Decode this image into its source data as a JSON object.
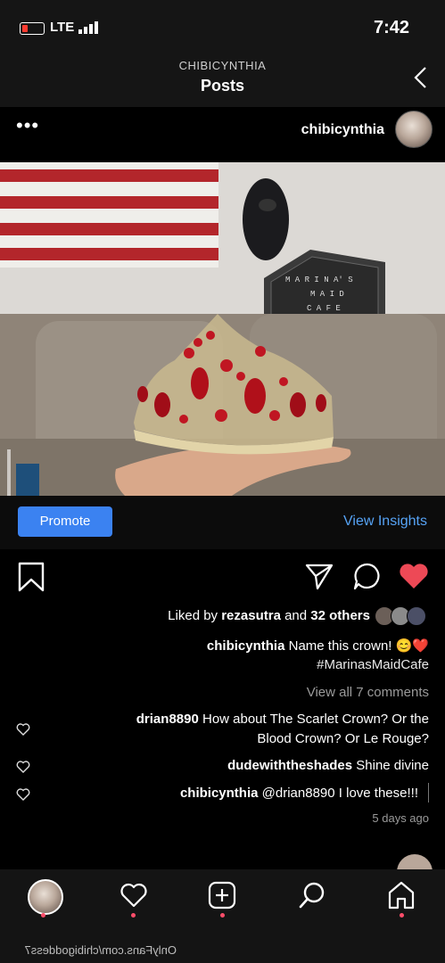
{
  "status_bar": {
    "network": "LTE",
    "time": "7:42"
  },
  "header": {
    "username": "CHIBICYNTHIA",
    "title": "Posts"
  },
  "post": {
    "username": "chibicynthia",
    "more": "•••",
    "promote_label": "Promote",
    "insights_label": "View Insights",
    "likes": {
      "prefix": "Liked by ",
      "user": "rezasutra",
      "middle": " and ",
      "others": "32 others"
    },
    "caption": {
      "user": "chibicynthia",
      "text": " Name this crown! 😊❤️",
      "hashtag": "#MarinasMaidCafe"
    },
    "view_comments": "View all 7 comments",
    "comments": [
      {
        "user": "drian8890",
        "line1": " How about The Scarlet Crown? Or the",
        "line2": "Blood Crown? Or Le Rouge?"
      },
      {
        "user": "dudewiththeshades",
        "line1": " Shine divine"
      },
      {
        "user": "chibicynthia",
        "line1": " @drian8890 I love these!!!"
      }
    ],
    "time_ago": "5 days ago"
  },
  "photo": {
    "sign_text": [
      "M A R I N A' S",
      "M A I D",
      "C A F E"
    ]
  },
  "watermark": "OnlyFans.com/chibigoddess7",
  "colors": {
    "accent_blue": "#3b82f1",
    "link_blue": "#56a3f5",
    "like_red": "#ed4956"
  }
}
